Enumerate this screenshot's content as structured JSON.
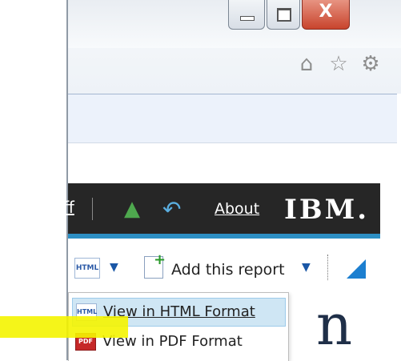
{
  "window": {
    "minimize_label": "",
    "maximize_label": "",
    "close_label": "X"
  },
  "browser_icons": [
    "home-icon",
    "star-icon",
    "gear-icon"
  ],
  "ibm_bar": {
    "partial_link": "ff",
    "about_label": "About",
    "logo_text": "IBM."
  },
  "toolbar": {
    "html_icon_text": "HTML",
    "add_report_label": "Add this report"
  },
  "menu": {
    "items": [
      {
        "icon_text": "HTML",
        "label": "View in HTML Format"
      },
      {
        "icon_text": "PDF",
        "label": "View in PDF Format"
      }
    ]
  },
  "background_glyph": "n",
  "colors": {
    "ibm_bar": "#262626",
    "ibm_underline": "#2d8fc4",
    "menu_hover": "#cfe6f4",
    "highlight": "#f4f400"
  }
}
